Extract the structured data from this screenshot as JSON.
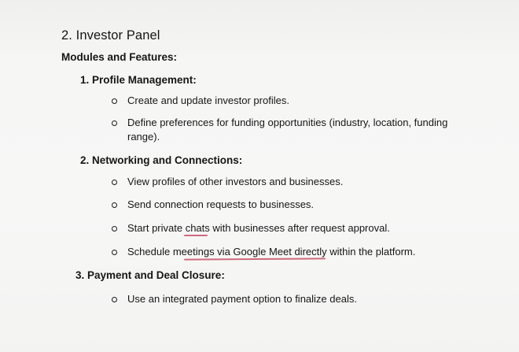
{
  "section": {
    "title": "2. Investor Panel",
    "subheading": "Modules and Features:"
  },
  "modules": [
    {
      "heading": "1. Profile Management:",
      "bullets": [
        "Create and update investor profiles.",
        "Define preferences for funding opportunities (industry, location, funding range)."
      ]
    },
    {
      "heading": "2. Networking and Connections:",
      "bullets": [
        "View profiles of other investors and businesses.",
        "Send connection requests to businesses.",
        "Start private chats with businesses after request approval.",
        "Schedule meetings via Google Meet directly within the platform."
      ]
    },
    {
      "heading": "3. Payment and Deal Closure:",
      "bullets": [
        "Use an integrated payment option to finalize deals."
      ]
    }
  ]
}
